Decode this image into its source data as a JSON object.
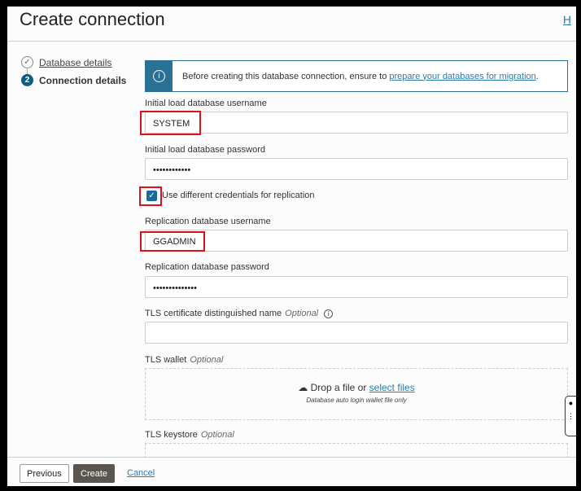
{
  "header": {
    "title": "Create connection",
    "help_link": "H"
  },
  "steps": [
    {
      "label": "Database details",
      "icon": "check-icon"
    },
    {
      "label": "Connection details",
      "number": "2"
    }
  ],
  "banner": {
    "text": "Before creating this database connection, ensure to ",
    "link": "prepare your databases for migration",
    "suffix": "."
  },
  "fields": {
    "initial_user_label": "Initial load database username",
    "initial_user_value": "SYSTEM",
    "initial_pass_label": "Initial load database password",
    "initial_pass_value": "••••••••••••",
    "diff_creds_label": "Use different credentials for replication",
    "repl_user_label": "Replication database username",
    "repl_user_value": "GGADMIN",
    "repl_pass_label": "Replication database password",
    "repl_pass_value": "••••••••••••••",
    "tls_dn_label": "TLS certificate distinguished name",
    "optional": "Optional",
    "tls_wallet_label": "TLS wallet",
    "drop_text": "Drop a file or ",
    "drop_link": "select files",
    "drop_sub": "Database auto login wallet file only",
    "tls_keystore_label": "TLS keystore"
  },
  "footer": {
    "previous": "Previous",
    "create": "Create",
    "cancel": "Cancel"
  }
}
